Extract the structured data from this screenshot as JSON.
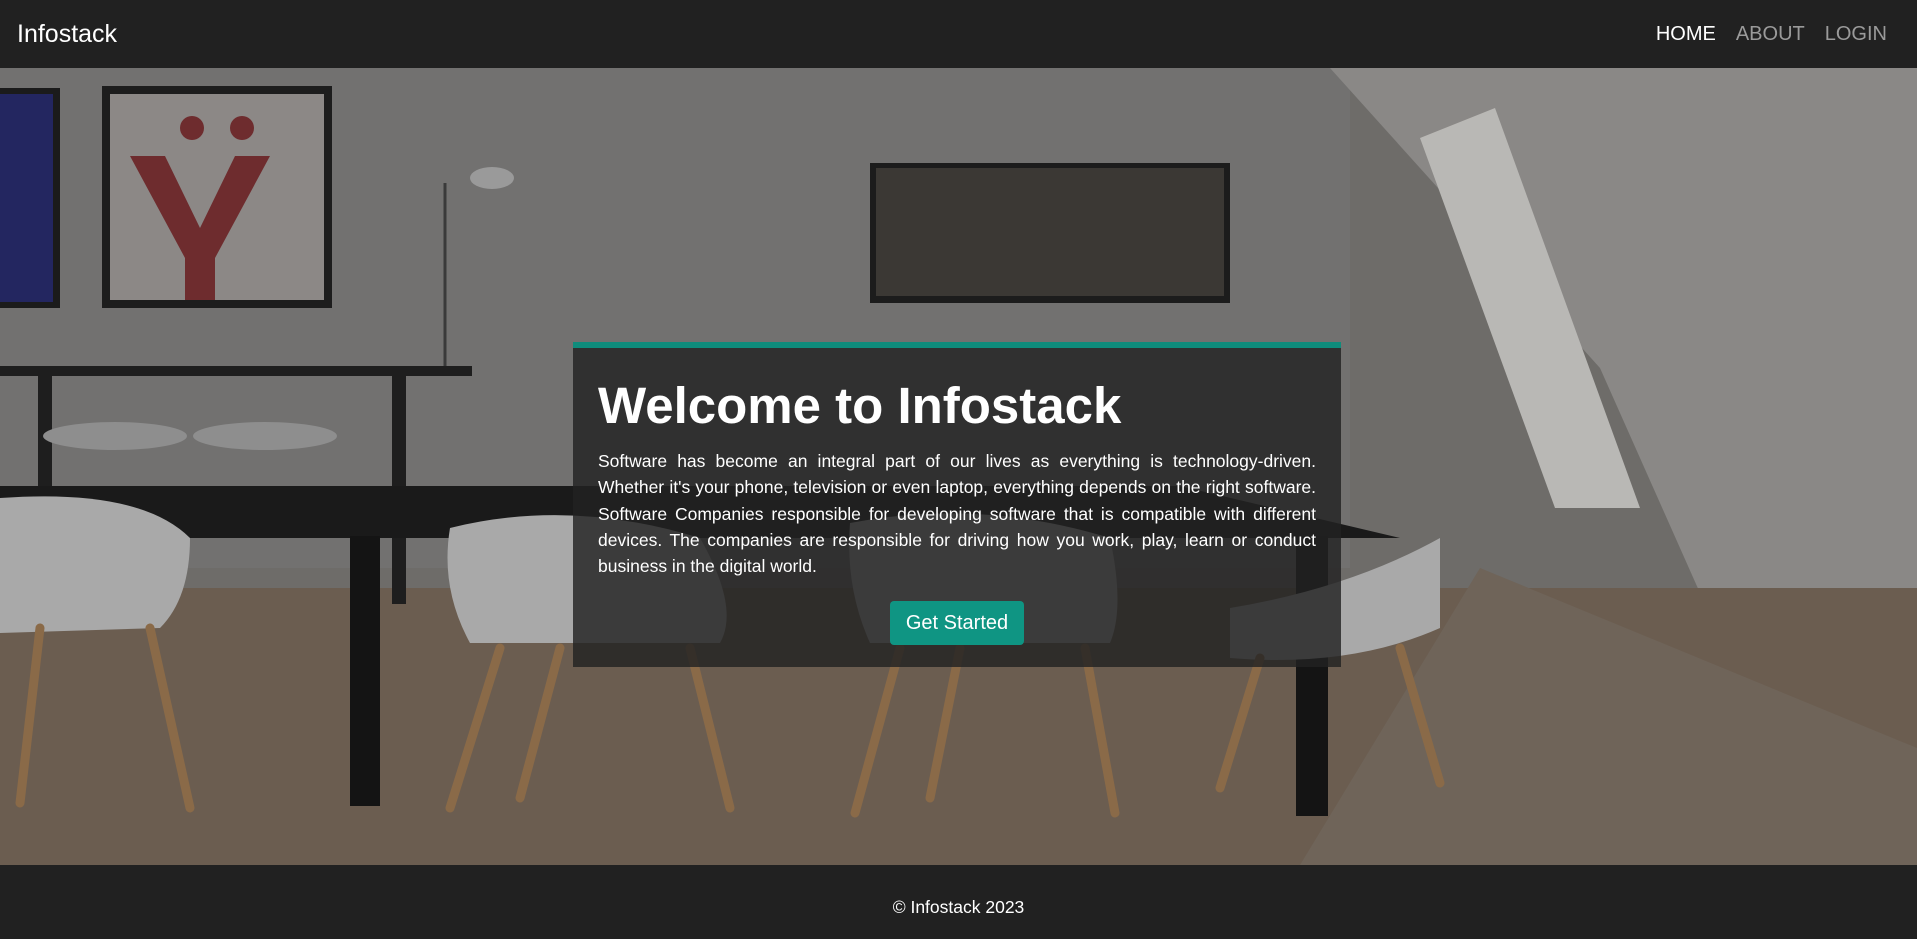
{
  "navbar": {
    "brand": "Infostack",
    "links": [
      {
        "label": "HOME",
        "active": true
      },
      {
        "label": "ABOUT",
        "active": false
      },
      {
        "label": "LOGIN",
        "active": false
      }
    ]
  },
  "hero": {
    "background_image": "office meeting room with table, white chairs, wall TV and framed posters",
    "title": "Welcome to Infostack",
    "paragraph": "Software has become an integral part of our lives as everything is technology-driven. Whether it's your phone, television or even laptop, everything depends on the right software. Software Companies responsible for developing software that is compatible with different devices. The companies are responsible for driving how you work, play, learn or conduct business in the digital world.",
    "cta_label": "Get Started"
  },
  "footer": {
    "text": "© Infostack 2023"
  },
  "colors": {
    "nav_bg": "#212121",
    "accent": "#0f9583",
    "card_border": "#0f8c7c",
    "link_inactive": "#9a9a9a",
    "text_light": "#ffffff"
  }
}
